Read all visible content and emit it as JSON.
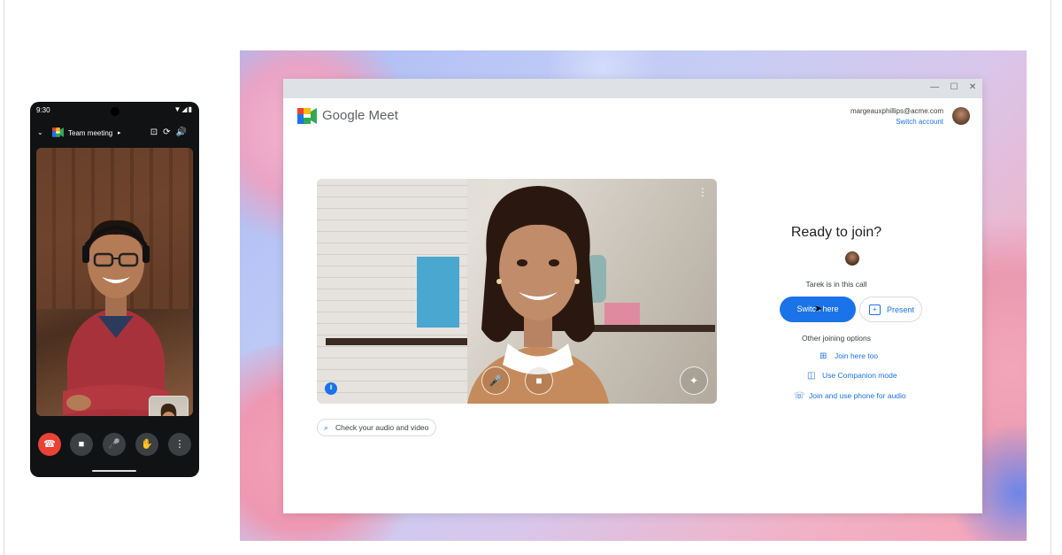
{
  "phone": {
    "status_time": "9:30",
    "status_icons": "▼◢▮",
    "meeting_name": "Team meeting",
    "caret": "▸",
    "chevron": "⌄",
    "header_icons": "⊡⟳🔊",
    "controls": {
      "end_call_icon": "☎",
      "camera_icon": "■",
      "mic_icon": "🎤",
      "hand_icon": "✋",
      "more_icon": "⋮"
    }
  },
  "window": {
    "controls": {
      "minimize": "—",
      "maximize": "☐",
      "close": "✕"
    },
    "brand_name": "Google Meet",
    "account": {
      "email": "margeauxphillips@acme.com",
      "switch_label": "Switch account"
    }
  },
  "preview": {
    "more_icon": "⋮",
    "mic_icon": "🎤",
    "camera_icon": "■",
    "effects_icon": "✦",
    "audio_icon": "⦀"
  },
  "check_audio_video": {
    "icon": "⌕",
    "label": "Check your audio and video"
  },
  "join": {
    "title": "Ready to join?",
    "in_call_text": "Tarek is in this call",
    "switch_here_label": "Switch here",
    "present_label": "Present",
    "present_icon": "+",
    "other_options_label": "Other joining options",
    "options": [
      {
        "icon": "⊞",
        "label": "Join here too"
      },
      {
        "icon": "◫",
        "label": "Use Companion mode"
      },
      {
        "icon": "☏",
        "label": "Join and use phone for audio"
      }
    ]
  },
  "colors": {
    "accent": "#1a73e8",
    "end_call": "#ea4335",
    "phone_body": "#101214"
  }
}
